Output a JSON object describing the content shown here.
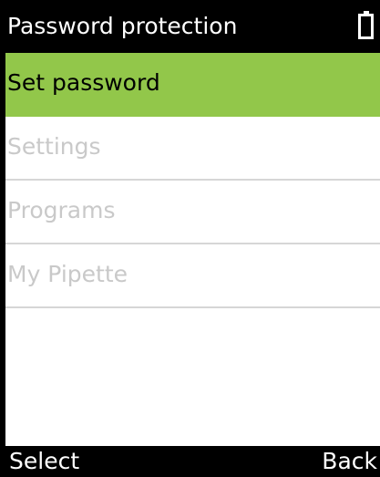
{
  "header": {
    "title": "Password protection",
    "battery_icon": "battery-icon"
  },
  "menu": {
    "selected_index": 0,
    "items": [
      {
        "label": "Set password"
      },
      {
        "label": "Settings"
      },
      {
        "label": "Programs"
      },
      {
        "label": "My Pipette"
      }
    ]
  },
  "footer": {
    "left_softkey": "Select",
    "right_softkey": "Back"
  },
  "colors": {
    "highlight": "#92c74a",
    "disabled_text": "#c9c9c9",
    "bar_background": "#000000"
  }
}
